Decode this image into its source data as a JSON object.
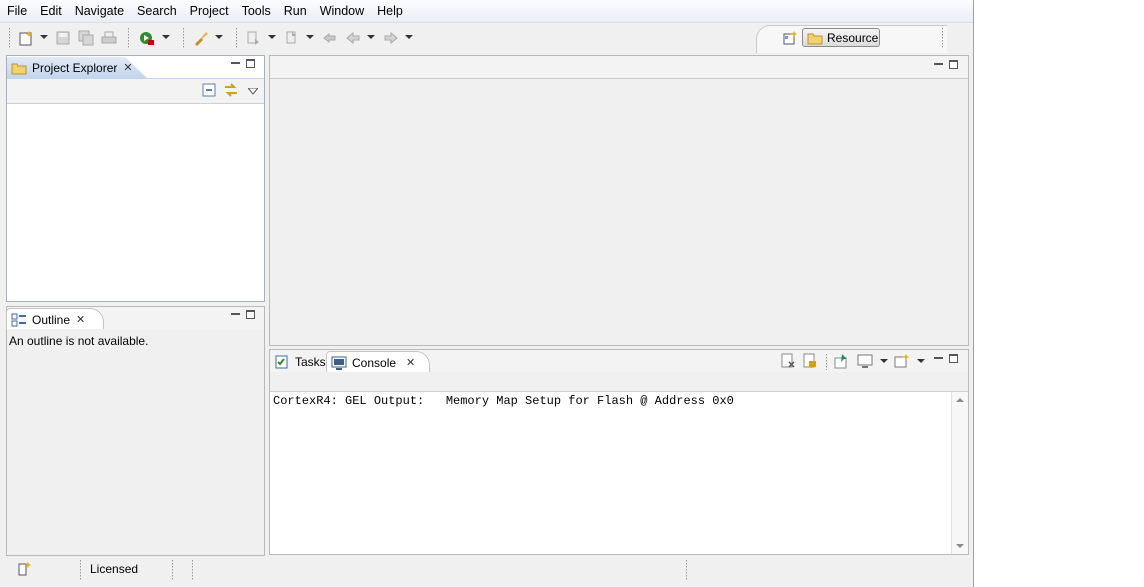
{
  "menu": [
    "File",
    "Edit",
    "Navigate",
    "Search",
    "Project",
    "Tools",
    "Run",
    "Window",
    "Help"
  ],
  "toolbar": {
    "perspective_label": "Resource"
  },
  "project_explorer": {
    "title": "Project Explorer",
    "close_glyph": "✕"
  },
  "outline": {
    "title": "Outline",
    "close_glyph": "✕",
    "message": "An outline is not available."
  },
  "bottom_tabs": {
    "tasks_label": "Tasks",
    "console_label": "Console",
    "close_glyph": "✕"
  },
  "console": {
    "line": "CortexR4: GEL Output:   Memory Map Setup for Flash @ Address 0x0"
  },
  "status": {
    "license": "Licensed"
  },
  "colors": {
    "accent_tab": "#c3d5ec",
    "panel_border": "#a4b0c0",
    "window_bg": "#f0f0f0"
  }
}
